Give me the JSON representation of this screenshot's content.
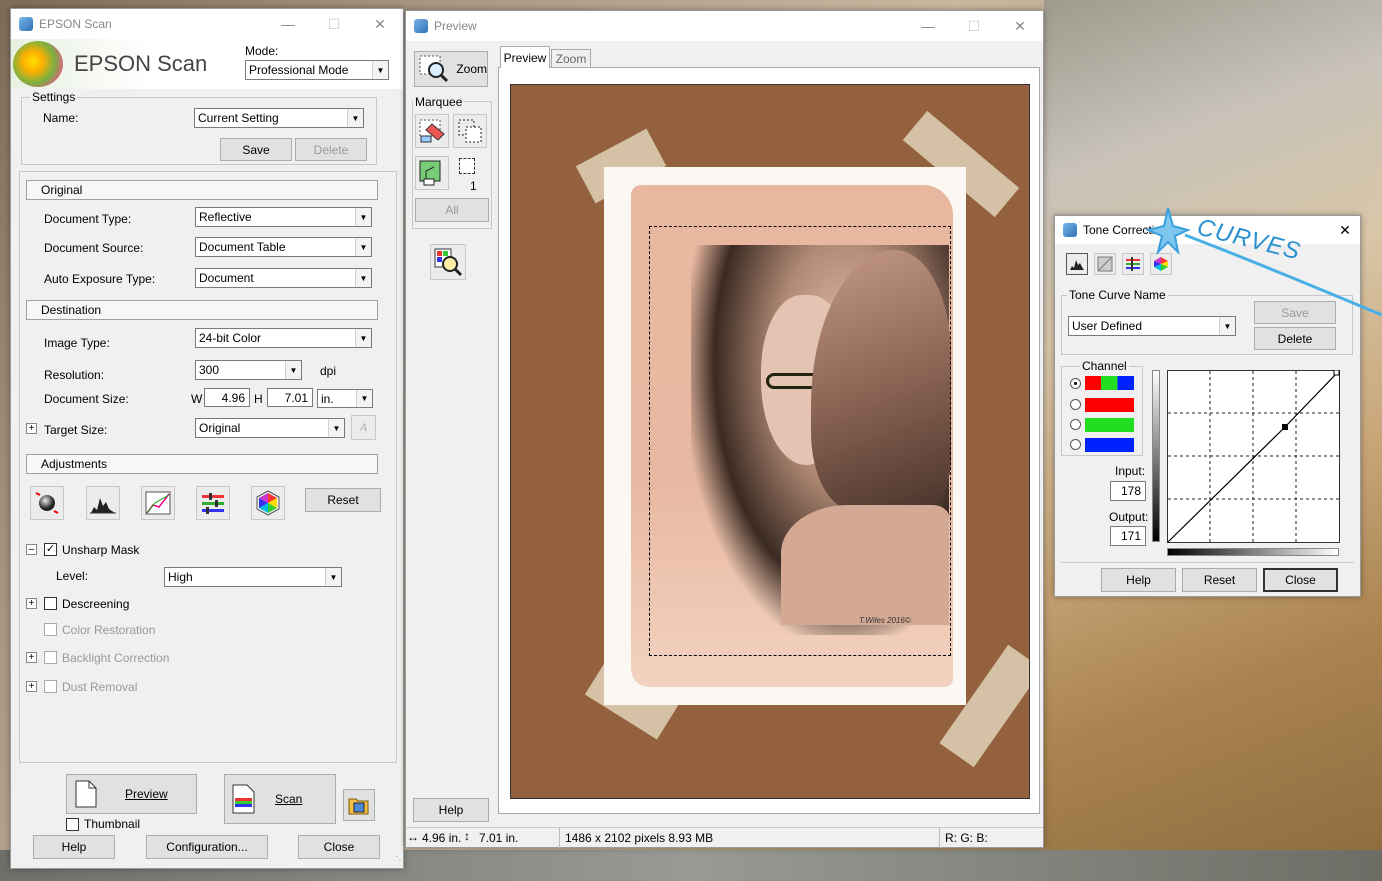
{
  "epson": {
    "title": "EPSON Scan",
    "logo": "EPSON Scan",
    "mode_label": "Mode:",
    "mode_value": "Professional Mode",
    "settings": {
      "group": "Settings",
      "name_label": "Name:",
      "name_value": "Current Setting",
      "save": "Save",
      "delete": "Delete"
    },
    "original": {
      "header": "Original",
      "doc_type_label": "Document Type:",
      "doc_type": "Reflective",
      "doc_source_label": "Document Source:",
      "doc_source": "Document Table",
      "auto_exp_label": "Auto Exposure Type:",
      "auto_exp": "Document"
    },
    "destination": {
      "header": "Destination",
      "image_type_label": "Image Type:",
      "image_type": "24-bit Color",
      "resolution_label": "Resolution:",
      "resolution": "300",
      "dpi": "dpi",
      "doc_size_label": "Document Size:",
      "w_label": "W",
      "w": "4.96",
      "h_label": "H",
      "h": "7.01",
      "unit": "in.",
      "target_label": "Target Size:",
      "target": "Original"
    },
    "adjustments": {
      "header": "Adjustments",
      "reset": "Reset",
      "unsharp": "Unsharp Mask",
      "level_label": "Level:",
      "level": "High",
      "descreening": "Descreening",
      "color_restoration": "Color Restoration",
      "backlight": "Backlight Correction",
      "dust": "Dust Removal"
    },
    "preview_btn": "Preview",
    "scan_btn": "Scan",
    "thumbnail": "Thumbnail",
    "help": "Help",
    "configuration": "Configuration...",
    "close": "Close"
  },
  "preview": {
    "title": "Preview",
    "zoom": "Zoom",
    "marquee": "Marquee",
    "count": "1",
    "all": "All",
    "tab_preview": "Preview",
    "tab_zoom": "Zoom",
    "help": "Help",
    "size_w": "4.96 in.",
    "size_h": "7.01 in.",
    "pixels": "1486 x 2102 pixels 8.93 MB",
    "rgb": "R: G: B:",
    "signature": "T.Wiles 2016©"
  },
  "tone": {
    "title": "Tone Correction",
    "curve_group": "Tone Curve Name",
    "curve_value": "User Defined",
    "save": "Save",
    "delete": "Delete",
    "channel": "Channel",
    "input_label": "Input:",
    "input": "178",
    "output_label": "Output:",
    "output": "171",
    "help": "Help",
    "reset": "Reset",
    "close": "Close",
    "annotation": "CURVES"
  },
  "colors": {
    "channel_red": "#ff0000",
    "channel_green": "#22dd22",
    "channel_blue": "#0022ff"
  }
}
